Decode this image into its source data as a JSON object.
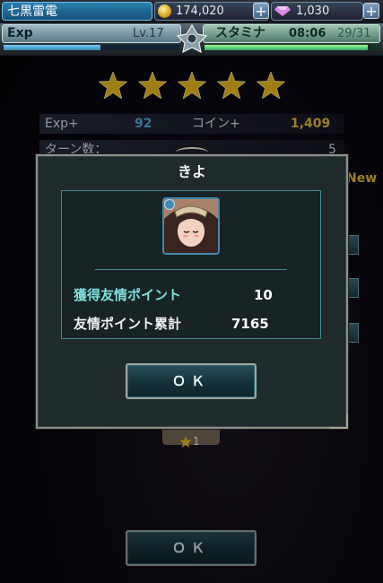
{
  "header": {
    "player_name": "七黒雷電",
    "coins": "174,020",
    "gems": "1,030",
    "plus_label": "+",
    "exp_label": "Exp",
    "level": "Lv.17",
    "stamina_label": "スタミナ",
    "stamina_timer": "08:06",
    "stamina_value": "29/31",
    "exp_progress": 0.55,
    "stamina_progress": 0.94
  },
  "result": {
    "star_rating": 5,
    "exp_label": "Exp+",
    "exp_value": "92",
    "coin_label": "コイン+",
    "coin_value": "1,409",
    "turns_label": "ターン数：",
    "turns_value": "5",
    "new_label": "New",
    "friend_star_count": "1",
    "ok_label": "ＯＫ"
  },
  "dialog": {
    "title": "きよ",
    "earned_label": "獲得友情ポイント",
    "earned_value": "10",
    "total_label": "友情ポイント累計",
    "total_value": "7165",
    "ok_label": "ＯＫ"
  },
  "colors": {
    "star": "#f4c21e",
    "accent_cyan": "#7fe0dc",
    "coin_text": "#f0c33a",
    "new_text": "#f0c33a"
  }
}
